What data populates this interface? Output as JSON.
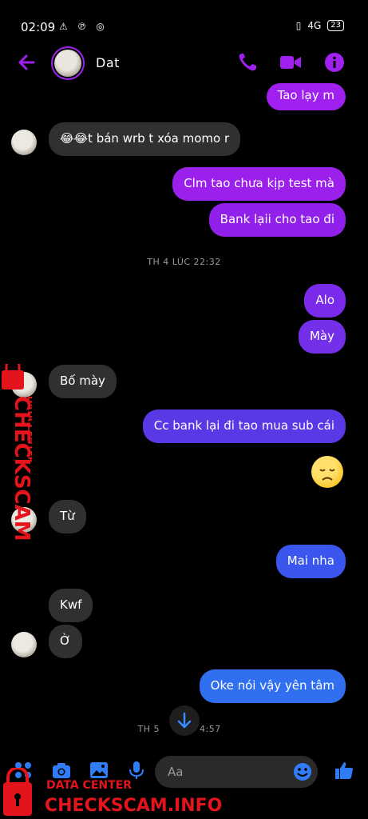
{
  "status": {
    "time": "02:09",
    "battery": "23",
    "network": "4G"
  },
  "header": {
    "contact_name": "Dat"
  },
  "colors": {
    "accent": "#a020f0",
    "out_purple": "#8a22e8",
    "out_blue": "#2f6ff0",
    "in_gray": "#303030"
  },
  "messages": [
    {
      "side": "out",
      "text": "Tao lạy m"
    },
    {
      "side": "in",
      "text": "😂😂t bán wrb t xóa momo r"
    },
    {
      "side": "out",
      "text": "Clm tao chưa kịp test mà"
    },
    {
      "side": "out",
      "text": "Bank lạii cho tao đi"
    },
    {
      "side": "out",
      "text": "Alo"
    },
    {
      "side": "out",
      "text": "Mày"
    },
    {
      "side": "in",
      "text": "Bố mày"
    },
    {
      "side": "out",
      "text": "Cc bank lại đi tao mua sub cái"
    },
    {
      "side": "out",
      "text": "😞"
    },
    {
      "side": "in",
      "text": "Từ"
    },
    {
      "side": "out",
      "text": "Mai nha"
    },
    {
      "side": "in",
      "text": "Kwf"
    },
    {
      "side": "in",
      "text": "Ờ"
    },
    {
      "side": "out",
      "text": "Oke nói vậy yên tâm"
    }
  ],
  "timestamps": {
    "t1": "TH 4 LÚC 22:32",
    "t2_left": "TH 5",
    "t2_right": "4:57"
  },
  "composer": {
    "placeholder": "Aa"
  },
  "watermark": {
    "brand": "CHECKSCAM.INFO",
    "sub": "DATA CENTER"
  }
}
